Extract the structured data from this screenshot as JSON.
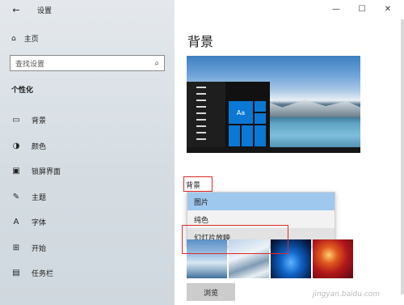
{
  "window": {
    "title": "设置",
    "back_icon": "←",
    "minimize": "—",
    "maximize": "☐",
    "close": "✕"
  },
  "sidebar": {
    "home": {
      "label": "主页",
      "icon": "home-icon"
    },
    "search": {
      "placeholder": "查找设置",
      "icon": "search-icon"
    },
    "section": "个性化",
    "items": [
      {
        "label": "背景",
        "icon": "picture-icon",
        "glyph": "▭",
        "active": true
      },
      {
        "label": "颜色",
        "icon": "palette-icon",
        "glyph": "◑",
        "active": false
      },
      {
        "label": "锁屏界面",
        "icon": "lock-screen-icon",
        "glyph": "▣",
        "active": false
      },
      {
        "label": "主题",
        "icon": "theme-icon",
        "glyph": "✎",
        "active": false
      },
      {
        "label": "字体",
        "icon": "font-icon",
        "glyph": "A",
        "active": false
      },
      {
        "label": "开始",
        "icon": "start-icon",
        "glyph": "⊞",
        "active": false
      },
      {
        "label": "任务栏",
        "icon": "taskbar-icon",
        "glyph": "▤",
        "active": false
      }
    ]
  },
  "main": {
    "title": "背景",
    "preview_sample": "Aa",
    "background_label": "背景",
    "dropdown_options": [
      {
        "label": "图片",
        "state": "selected"
      },
      {
        "label": "纯色",
        "state": "normal"
      },
      {
        "label": "幻灯片放映",
        "state": "hover"
      }
    ],
    "browse_label": "浏览"
  },
  "watermark": "jingyan.baidu.com",
  "colors": {
    "accent": "#0a78d4",
    "selected": "#9fc8ee",
    "highlight_box": "#e02a2a"
  }
}
